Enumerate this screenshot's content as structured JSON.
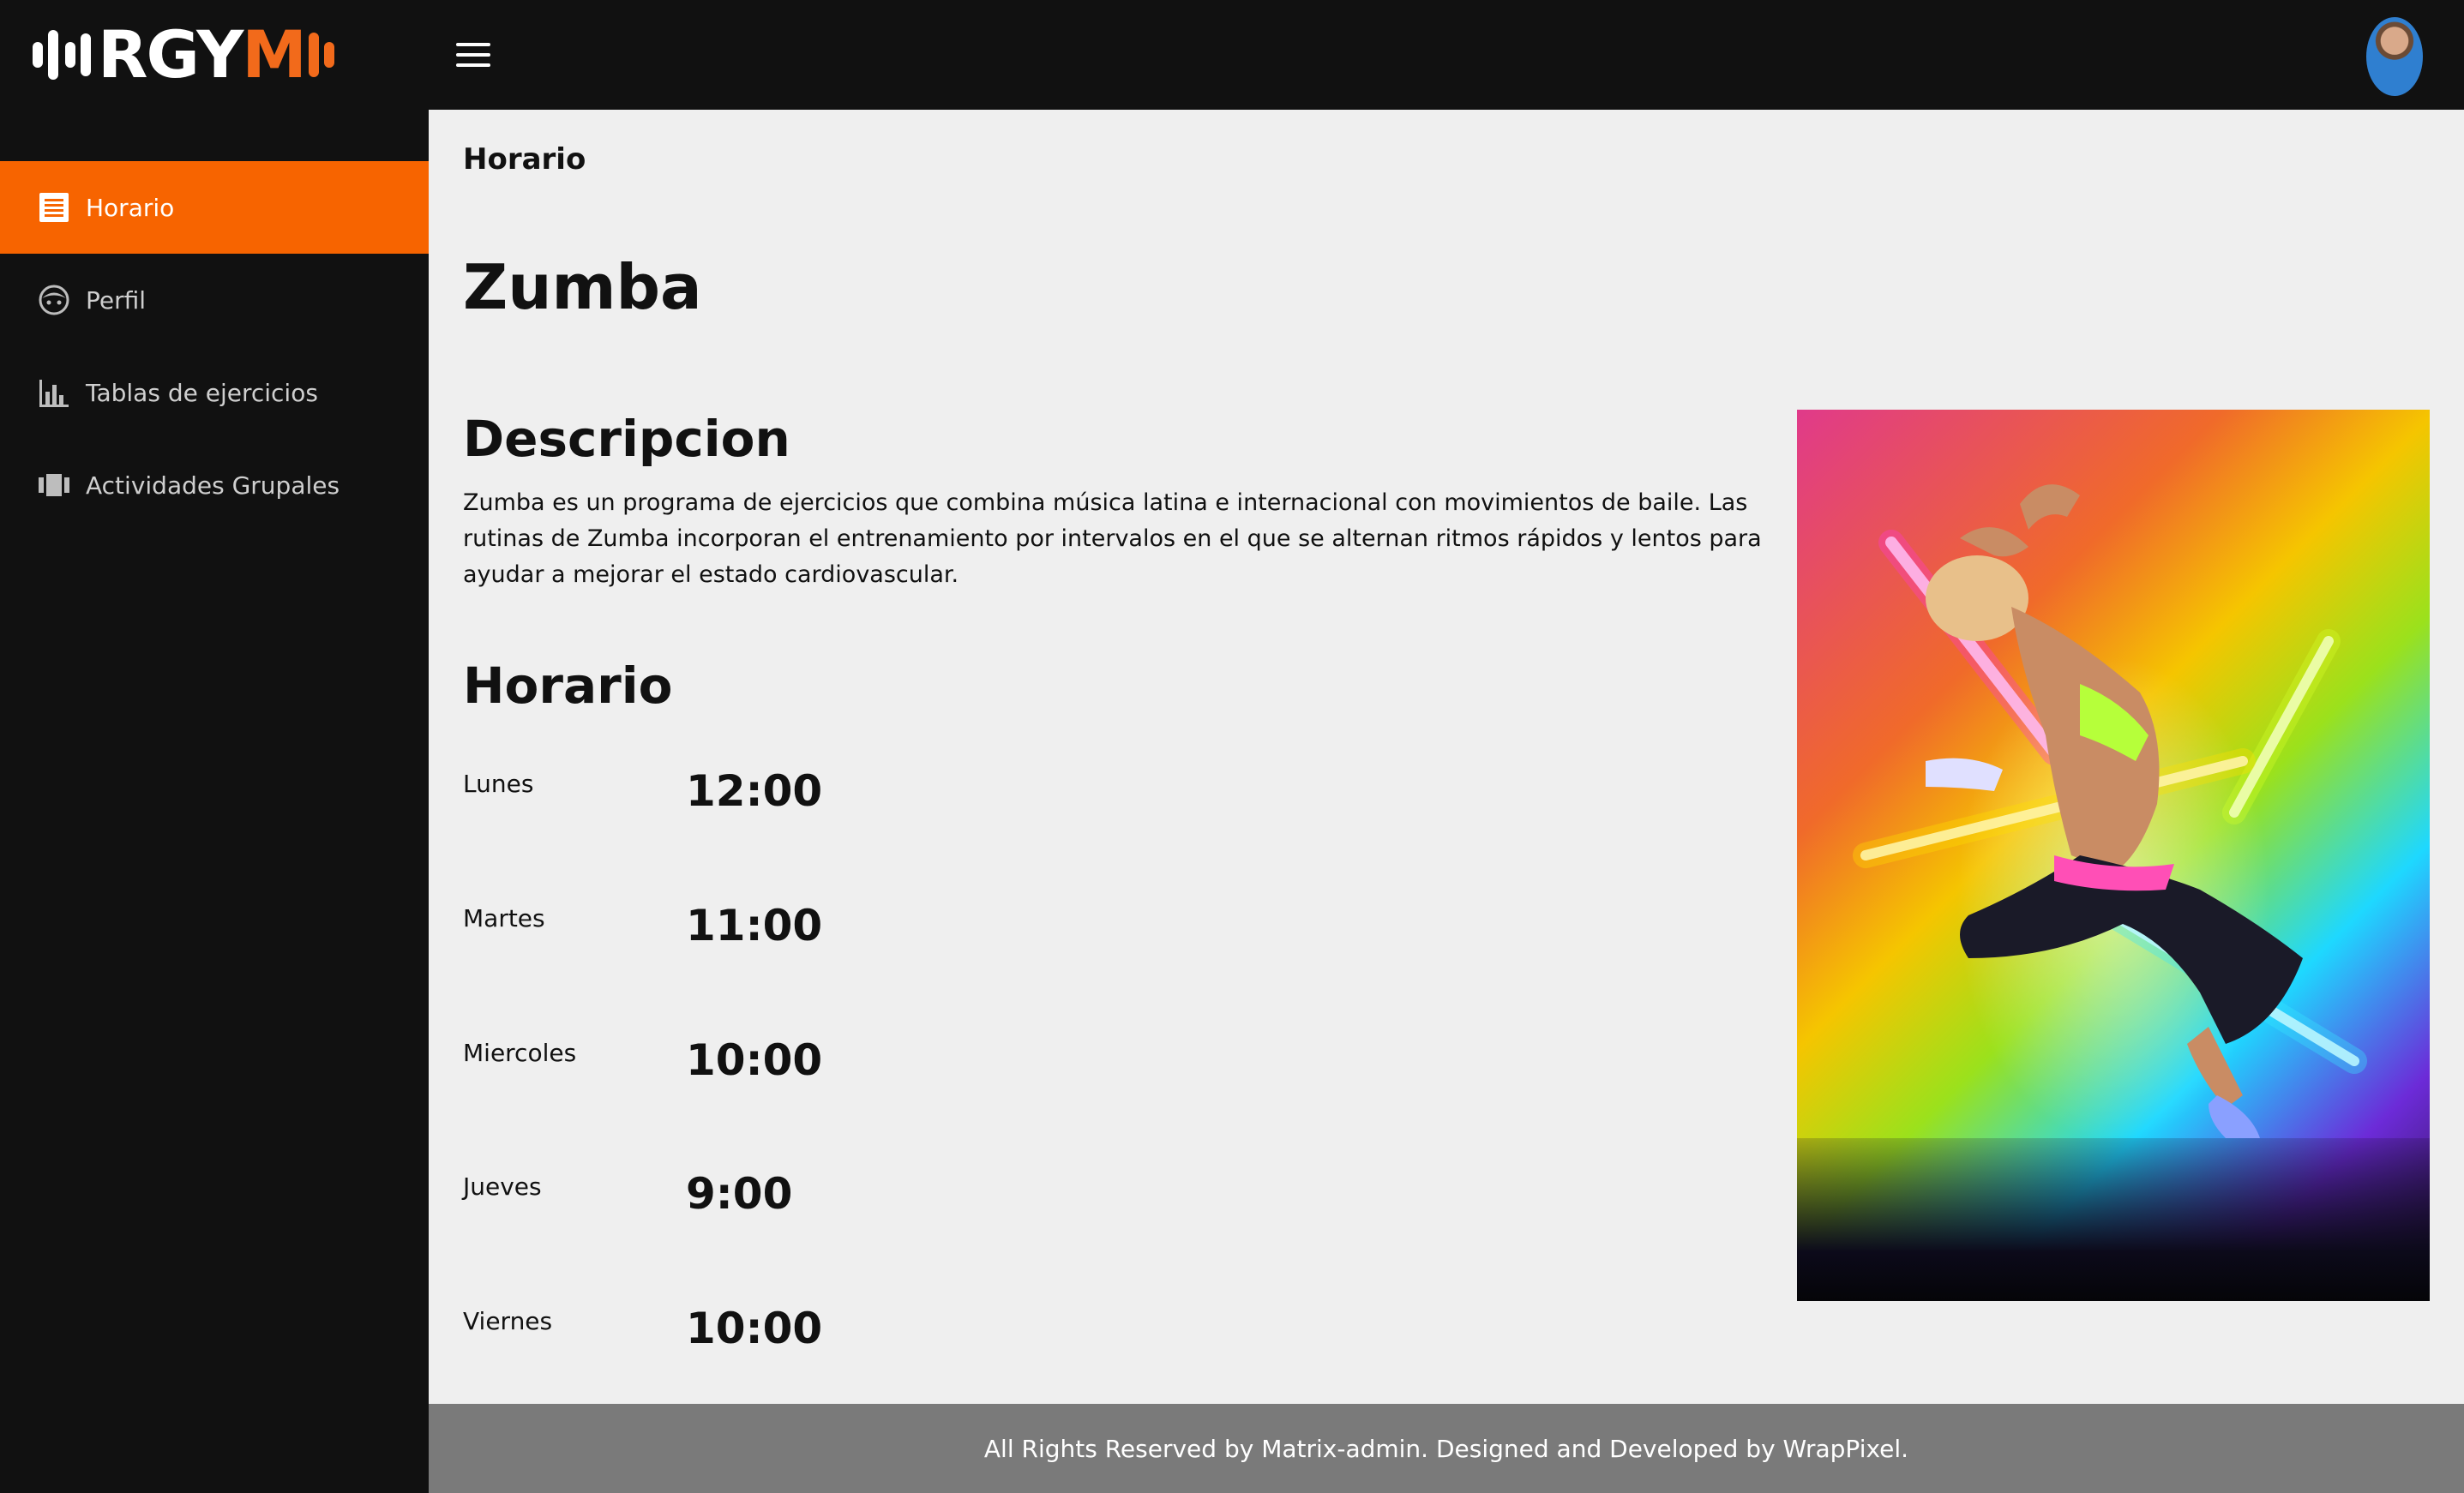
{
  "app": {
    "logo_text_white": "RGY",
    "logo_text_accent": "M",
    "accent_color": "#f26a1b",
    "topbar_color": "#111111",
    "menu_icon": "hamburger-icon",
    "avatar_icon": "user-avatar"
  },
  "sidebar": {
    "items": [
      {
        "label": "Horario",
        "icon": "schedule-icon",
        "active": true
      },
      {
        "label": "Perfil",
        "icon": "face-icon",
        "active": false
      },
      {
        "label": "Tablas de ejercicios",
        "icon": "bar-chart-icon",
        "active": false
      },
      {
        "label": "Actividades Grupales",
        "icon": "group-activity-icon",
        "active": false
      }
    ]
  },
  "main": {
    "breadcrumb": "Horario",
    "title": "Zumba",
    "description_heading": "Descripcion",
    "description": "Zumba es un programa de ejercicios que combina música latina e internacional con movimientos de baile. Las rutinas de Zumba incorporan el entrenamiento por intervalos en el que se alternan ritmos rápidos y lentos para ayudar a mejorar el estado cardiovascular.",
    "schedule_heading": "Horario",
    "schedule": [
      {
        "day": "Lunes",
        "time": "12:00"
      },
      {
        "day": "Martes",
        "time": "11:00"
      },
      {
        "day": "Miercoles",
        "time": "10:00"
      },
      {
        "day": "Jueves",
        "time": "9:00"
      },
      {
        "day": "Viernes",
        "time": "10:00"
      }
    ]
  },
  "footer": {
    "text": "All Rights Reserved by Matrix-admin. Designed and Developed by WrapPixel."
  }
}
